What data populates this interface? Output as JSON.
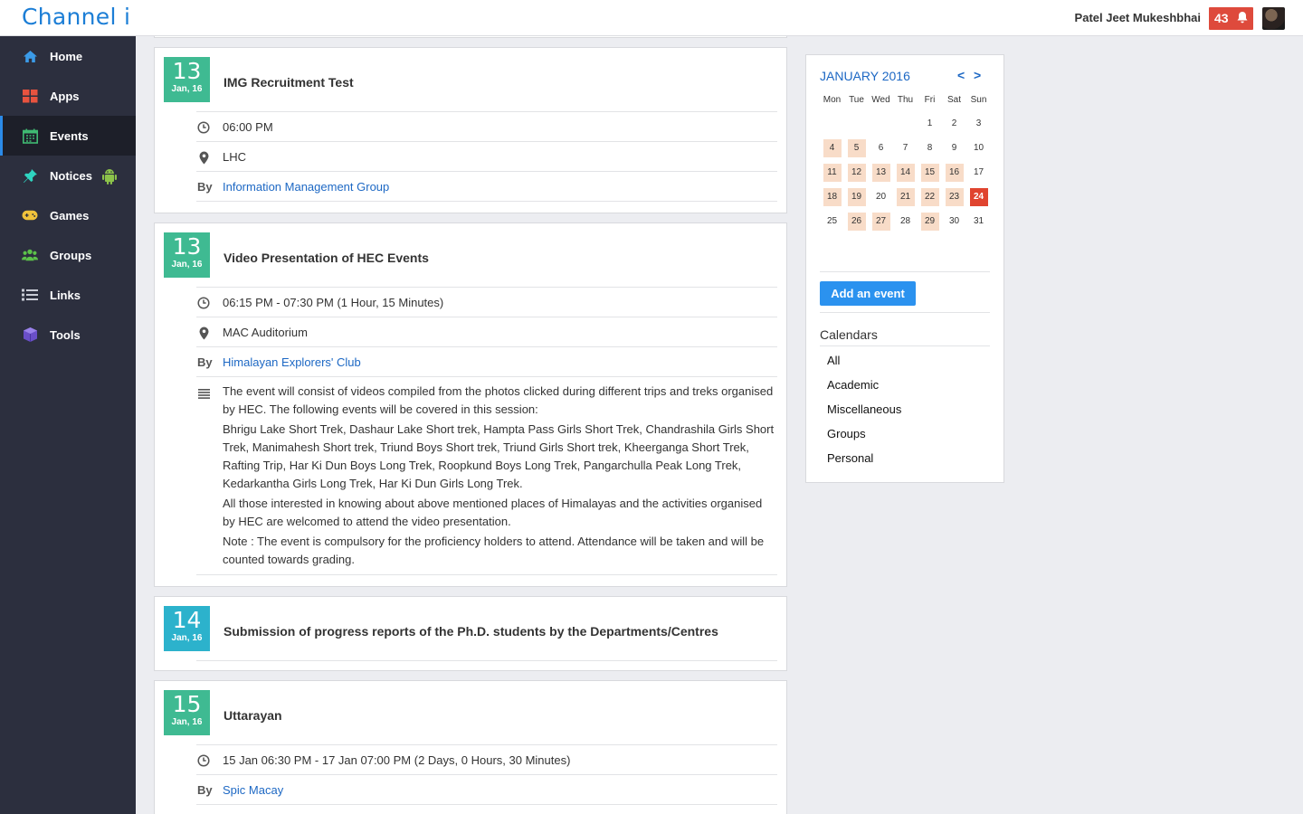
{
  "header": {
    "logo": "Channel i",
    "user_name": "Patel Jeet Mukeshbhai",
    "notification_count": "43"
  },
  "sidebar": {
    "items": [
      {
        "label": "Home",
        "icon": "home-icon",
        "color": "#3b9be8"
      },
      {
        "label": "Apps",
        "icon": "apps-grid-icon",
        "color": "#e8533f"
      },
      {
        "label": "Events",
        "icon": "calendar-icon",
        "color": "#3fba72"
      },
      {
        "label": "Notices",
        "icon": "pin-icon",
        "color": "#2fd4c0"
      },
      {
        "label": "Games",
        "icon": "gamepad-icon",
        "color": "#f0c23b"
      },
      {
        "label": "Groups",
        "icon": "groups-icon",
        "color": "#5cc24a"
      },
      {
        "label": "Links",
        "icon": "list-icon",
        "color": "#c9ccd6"
      },
      {
        "label": "Tools",
        "icon": "cube-icon",
        "color": "#7b5cd6"
      }
    ],
    "active": "Events"
  },
  "events": [
    {
      "day": "13",
      "month": "Jan, 16",
      "title": "IMG Recruitment Test",
      "time": "06:00 PM",
      "location": "LHC",
      "by_label": "By",
      "by": "Information Management Group"
    },
    {
      "day": "13",
      "month": "Jan, 16",
      "title": "Video Presentation of HEC Events",
      "time": "06:15 PM - 07:30 PM (1 Hour, 15 Minutes)",
      "location": "MAC Auditorium",
      "by_label": "By",
      "by": "Himalayan Explorers' Club",
      "description": [
        "The event will consist of  videos compiled from the photos clicked during different trips and treks organised by HEC. The following events will be covered in this session:",
        "Bhrigu Lake Short Trek, Dashaur Lake Short trek, Hampta Pass Girls Short Trek, Chandrashila Girls Short Trek, Manimahesh Short trek, Triund Boys Short trek, Triund Girls Short trek, Kheerganga Short Trek, Rafting Trip, Har Ki Dun Boys Long Trek, Roopkund Boys Long Trek, Pangarchulla Peak Long Trek, Kedarkantha Girls Long Trek, Har Ki Dun Girls Long Trek.",
        "All those interested in knowing about above mentioned places of Himalayas and the activities organised by HEC are welcomed to attend the video presentation.",
        "Note : The event is compulsory for the proficiency holders to attend. Attendance will be taken and will be counted towards grading."
      ]
    },
    {
      "day": "14",
      "month": "Jan, 16",
      "title": "Submission of progress reports of the Ph.D. students by the Departments/Centres"
    },
    {
      "day": "15",
      "month": "Jan, 16",
      "title": "Uttarayan",
      "time": "15 Jan 06:30 PM - 17 Jan 07:00 PM (2 Days, 0 Hours, 30 Minutes)",
      "by_label": "By",
      "by": "Spic Macay"
    }
  ],
  "calendar": {
    "title": "JANUARY 2016",
    "prev": "<",
    "next": ">",
    "weekdays": [
      "Mon",
      "Tue",
      "Wed",
      "Thu",
      "Fri",
      "Sat",
      "Sun"
    ],
    "weeks": [
      [
        "",
        "",
        "",
        "",
        "1",
        "2",
        "3"
      ],
      [
        "4",
        "5",
        "6",
        "7",
        "8",
        "9",
        "10"
      ],
      [
        "11",
        "12",
        "13",
        "14",
        "15",
        "16",
        "17"
      ],
      [
        "18",
        "19",
        "20",
        "21",
        "22",
        "23",
        "24"
      ],
      [
        "25",
        "26",
        "27",
        "28",
        "29",
        "30",
        "31"
      ]
    ],
    "highlighted_days": [
      "4",
      "5",
      "11",
      "12",
      "13",
      "14",
      "15",
      "16",
      "18",
      "19",
      "21",
      "22",
      "23",
      "26",
      "27",
      "29"
    ],
    "today": "24",
    "add_event_label": "Add an event",
    "calendars_heading": "Calendars",
    "calendars": [
      "All",
      "Academic",
      "Miscellaneous",
      "Groups",
      "Personal"
    ]
  },
  "colors": {
    "accent": "#2b92ef",
    "badge_green": "#3fba92",
    "badge_teal": "#2cb2cc",
    "today": "#e0442f",
    "event_day": "#f8dcc8",
    "notification": "#de4a3c"
  }
}
